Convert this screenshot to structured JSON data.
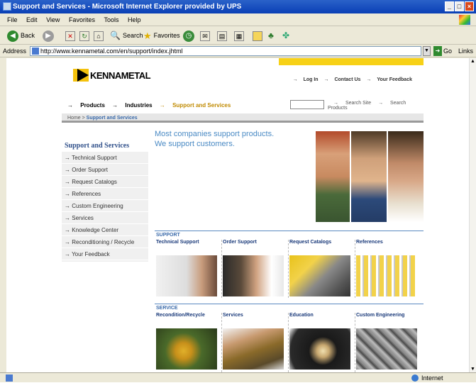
{
  "browser": {
    "title": "Support and Services - Microsoft Internet Explorer provided by UPS",
    "menu": [
      "File",
      "Edit",
      "View",
      "Favorites",
      "Tools",
      "Help"
    ],
    "toolbar": {
      "back": "Back",
      "search": "Search",
      "favorites": "Favorites"
    },
    "address_label": "Address",
    "url": "http://www.kennametal.com/en/support/index.jhtml",
    "go": "Go",
    "links": "Links",
    "status_zone": "Internet"
  },
  "site": {
    "logo": "KENNAMETAL",
    "top_links": [
      "Log In",
      "Contact Us",
      "Your Feedback"
    ],
    "nav": [
      {
        "label": "Products",
        "active": false
      },
      {
        "label": "Industries",
        "active": false
      },
      {
        "label": "Support and Services",
        "active": true
      }
    ],
    "search_links": [
      "Search Site",
      "Search Products"
    ],
    "breadcrumb": {
      "home": "Home",
      "sep": " > ",
      "current": "Support and Services"
    },
    "sidebar": {
      "title": "Support and Services",
      "items": [
        "Technical Support",
        "Order Support",
        "Request Catalogs",
        "References",
        "Custom Engineering",
        "Services",
        "Knowledge Center",
        "Reconditioning / Recycle",
        "Your Feedback"
      ]
    },
    "tagline": [
      "Most companies support products.",
      "We support customers."
    ],
    "support": {
      "heading": "SUPPORT",
      "tiles": [
        "Technical Support",
        "Order Support",
        "Request Catalogs",
        "References"
      ]
    },
    "service": {
      "heading": "SERVICE",
      "tiles": [
        "Recondition/Recycle",
        "Services",
        "Education",
        "Custom Engineering"
      ]
    }
  },
  "colors": {
    "brand_yellow": "#f7d117",
    "link_blue": "#3a6aaa",
    "tagline_blue": "#4a8ac4",
    "title_bar": "#0a3fb5"
  }
}
